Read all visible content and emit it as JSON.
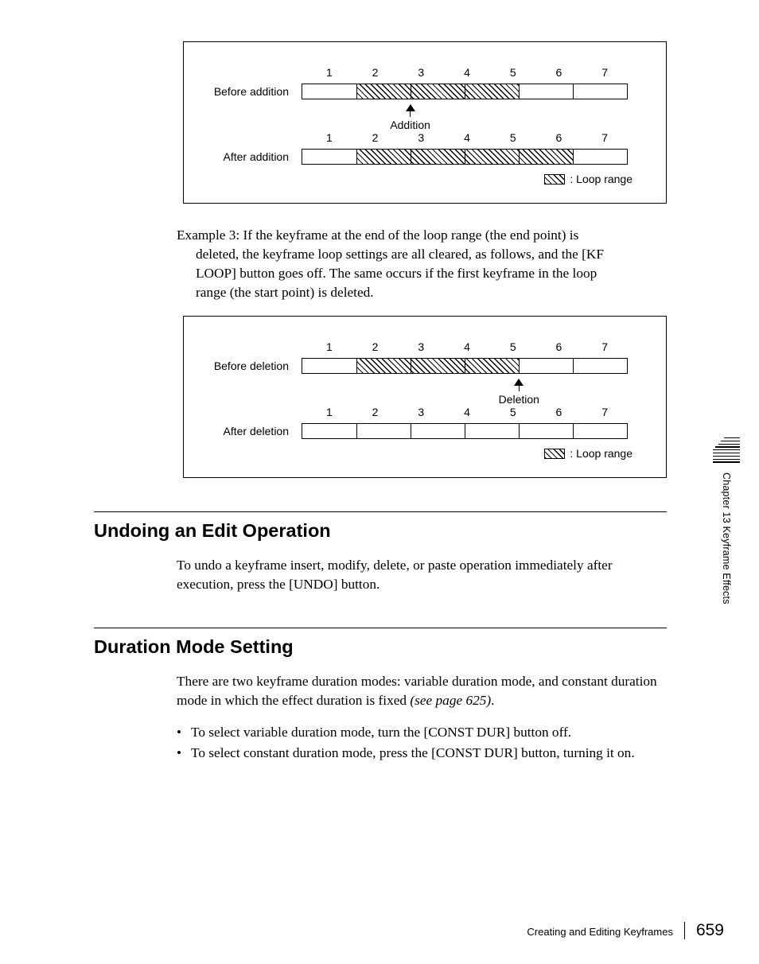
{
  "fig1": {
    "before_label": "Before addition",
    "after_label": "After addition",
    "numbers": [
      "1",
      "2",
      "3",
      "4",
      "5",
      "6",
      "7"
    ],
    "action_label": "Addition",
    "legend": ": Loop range"
  },
  "example3": {
    "lead": "Example 3: If the keyframe at the end of the loop range (the end point) is",
    "cont1": "deleted, the keyframe loop settings are all cleared, as follows, and the [KF",
    "cont2": "LOOP] button goes off. The same occurs if the first keyframe in the loop",
    "cont3": "range (the start point) is deleted."
  },
  "fig2": {
    "before_label": "Before deletion",
    "after_label": "After deletion",
    "numbers": [
      "1",
      "2",
      "3",
      "4",
      "5",
      "6",
      "7"
    ],
    "action_label": "Deletion",
    "legend": ": Loop range"
  },
  "section_undo": {
    "title": "Undoing an Edit Operation",
    "body": "To undo a keyframe insert, modify, delete, or paste operation immediately after execution, press the [UNDO] button."
  },
  "section_duration": {
    "title": "Duration Mode Setting",
    "body_a": "There are two keyframe duration modes: variable duration mode, and constant duration mode in which the effect duration is fixed ",
    "body_ref": "(see page 625)",
    "body_b": ".",
    "bullets": [
      "To select variable duration mode, turn the [CONST DUR] button off.",
      "To select constant duration mode, press the [CONST DUR] button, turning it on."
    ]
  },
  "sidetab": "Chapter 13  Keyframe Effects",
  "footer": {
    "title": "Creating and Editing Keyframes",
    "page": "659"
  }
}
